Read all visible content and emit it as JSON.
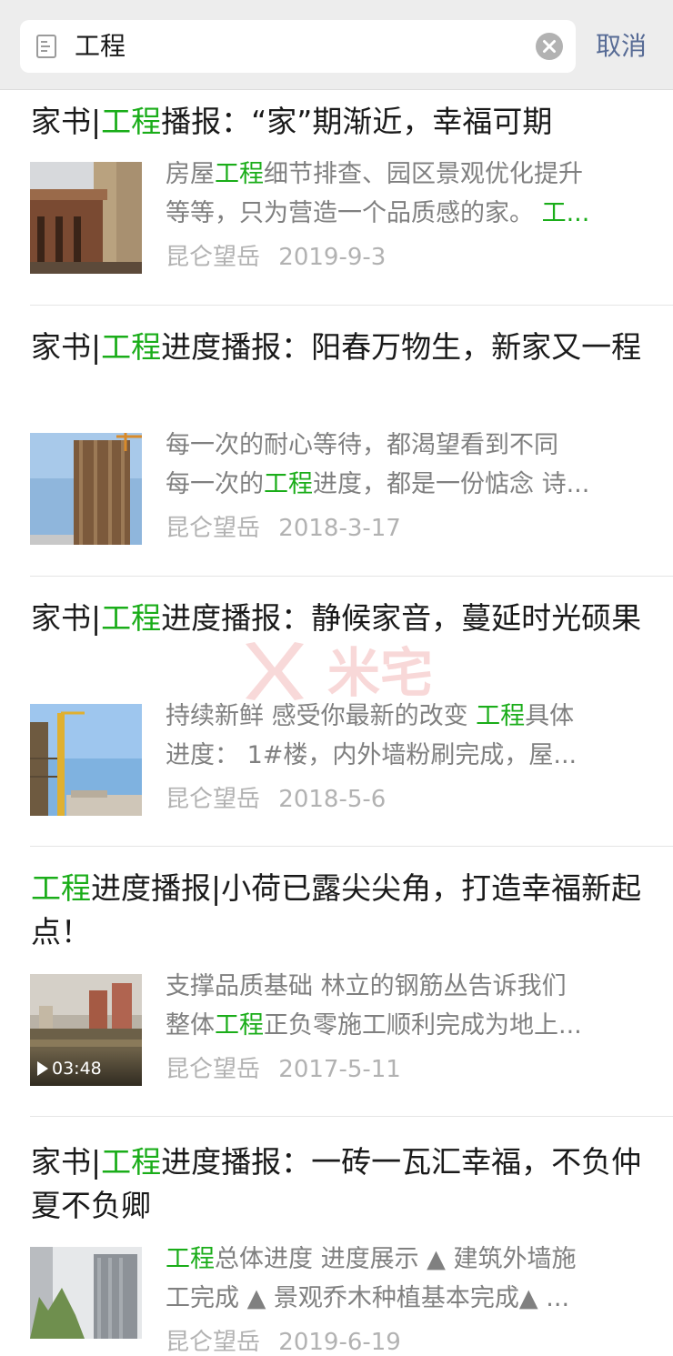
{
  "search": {
    "query": "工程",
    "cancel_label": "取消"
  },
  "results": [
    {
      "title_parts": [
        {
          "t": "家书|",
          "h": false
        },
        {
          "t": "工程",
          "h": true
        },
        {
          "t": "播报：“家”期渐近，幸福可期",
          "h": false
        }
      ],
      "desc_lines": [
        [
          {
            "t": "房屋",
            "h": false
          },
          {
            "t": "工程",
            "h": true
          },
          {
            "t": "细节排查、园区景观优化提升",
            "h": false
          }
        ],
        [
          {
            "t": "等等，只为营造一个品质感的家。 ",
            "h": false
          },
          {
            "t": "工...",
            "h": true
          }
        ]
      ],
      "source": "昆仑望岳",
      "date": "2019-9-3"
    },
    {
      "title_parts": [
        {
          "t": "家书|",
          "h": false
        },
        {
          "t": "工程",
          "h": true
        },
        {
          "t": "进度播报：阳春万物生，新家又一程",
          "h": false
        }
      ],
      "desc_lines": [
        [
          {
            "t": "每一次的耐心等待，都渴望看到不同",
            "h": false
          }
        ],
        [
          {
            "t": "每一次的",
            "h": false
          },
          {
            "t": "工程",
            "h": true
          },
          {
            "t": "进度，都是一份惦念 诗...",
            "h": false
          }
        ]
      ],
      "source": "昆仑望岳",
      "date": "2018-3-17"
    },
    {
      "title_parts": [
        {
          "t": "家书|",
          "h": false
        },
        {
          "t": "工程",
          "h": true
        },
        {
          "t": "进度播报：静候家音，蔓延时光硕果",
          "h": false
        }
      ],
      "desc_lines": [
        [
          {
            "t": "持续新鲜 感受你最新的改变 ",
            "h": false
          },
          {
            "t": "工程",
            "h": true
          },
          {
            "t": "具体",
            "h": false
          }
        ],
        [
          {
            "t": "进度： 1#楼，内外墙粉刷完成，屋...",
            "h": false
          }
        ]
      ],
      "source": "昆仑望岳",
      "date": "2018-5-6"
    },
    {
      "title_parts": [
        {
          "t": "工程",
          "h": true
        },
        {
          "t": "进度播报|小荷已露尖尖角，打造幸福新起点！",
          "h": false
        }
      ],
      "desc_lines": [
        [
          {
            "t": "支撑品质基础 林立的钢筋丛告诉我们",
            "h": false
          }
        ],
        [
          {
            "t": "整体",
            "h": false
          },
          {
            "t": "工程",
            "h": true
          },
          {
            "t": "正负零施工顺利完成为地上...",
            "h": false
          }
        ]
      ],
      "source": "昆仑望岳",
      "date": "2017-5-11",
      "video_duration": "03:48"
    },
    {
      "title_parts": [
        {
          "t": "家书|",
          "h": false
        },
        {
          "t": "工程",
          "h": true
        },
        {
          "t": "进度播报：一砖一瓦汇幸福，不负仲夏不负卿",
          "h": false
        }
      ],
      "desc_lines": [
        [
          {
            "t": "工程",
            "h": true
          },
          {
            "t": "总体进度 进度展示 ▲ 建筑外墙施",
            "h": false
          }
        ],
        [
          {
            "t": "工完成 ▲ 景观乔木种植基本完成▲ ...",
            "h": false
          }
        ]
      ],
      "source": "昆仑望岳",
      "date": "2019-6-19"
    }
  ],
  "watermark_text": "米宅",
  "colors": {
    "highlight": "#1aad19",
    "cancel": "#576b95",
    "meta": "#b2b2b2",
    "desc": "#808080"
  }
}
